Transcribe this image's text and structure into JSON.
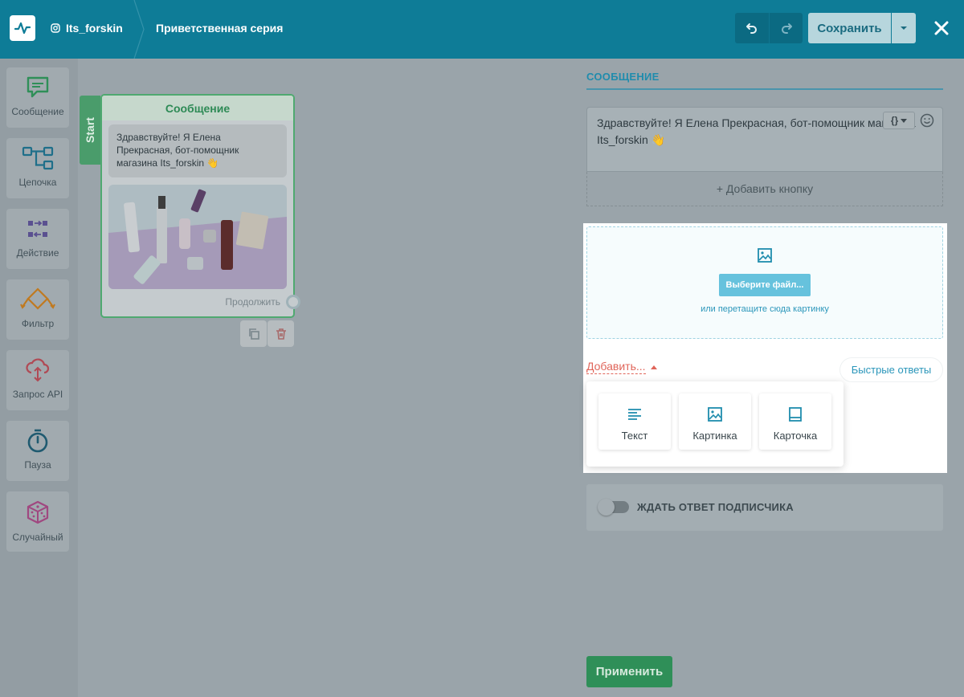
{
  "header": {
    "account": "Its_forskin",
    "title": "Приветственная серия",
    "save_label": "Сохранить"
  },
  "toolbar": {
    "items": [
      {
        "label": "Сообщение",
        "icon": "message-icon",
        "color": "#2f8f58"
      },
      {
        "label": "Цепочка",
        "icon": "chain-icon",
        "color": "#1f6f8a"
      },
      {
        "label": "Действие",
        "icon": "action-icon",
        "color": "#5a5090"
      },
      {
        "label": "Фильтр",
        "icon": "filter-icon",
        "color": "#c07a20"
      },
      {
        "label": "Запрос API",
        "icon": "api-cloud-icon",
        "color": "#b04a55"
      },
      {
        "label": "Пауза",
        "icon": "timer-icon",
        "color": "#1f5a70"
      },
      {
        "label": "Случайный",
        "icon": "dice-icon",
        "color": "#a04880"
      }
    ]
  },
  "node": {
    "start_label": "Start",
    "title": "Сообщение",
    "message": "Здравствуйте! Я Елена Прекрасная, бот-помощник магазина Its_forskin 👋",
    "continue_label": "Продолжить"
  },
  "panel": {
    "section_title": "СООБЩЕНИЕ",
    "message_text": "Здравствуйте! Я Елена Прекрасная, бот-помощник магазина Its_forskin 👋",
    "var_label": "{}",
    "add_button_label": "+ Добавить кнопку",
    "file_button_label": "Выберите файл...",
    "drop_hint": "или перетащите сюда картинку",
    "add_dropdown_label": "Добавить...",
    "quick_replies_label": "Быстрые ответы",
    "dropdown_items": [
      {
        "label": "Текст",
        "icon": "text-lines-icon"
      },
      {
        "label": "Картинка",
        "icon": "image-icon"
      },
      {
        "label": "Карточка",
        "icon": "card-icon"
      }
    ],
    "wait_label": "ЖДАТЬ ОТВЕТ ПОДПИСЧИКА",
    "apply_label": "Применить"
  },
  "colors": {
    "header_bg": "#0e7c97",
    "accent": "#1f8cad",
    "success": "#2f8f58",
    "danger": "#e0655a"
  }
}
